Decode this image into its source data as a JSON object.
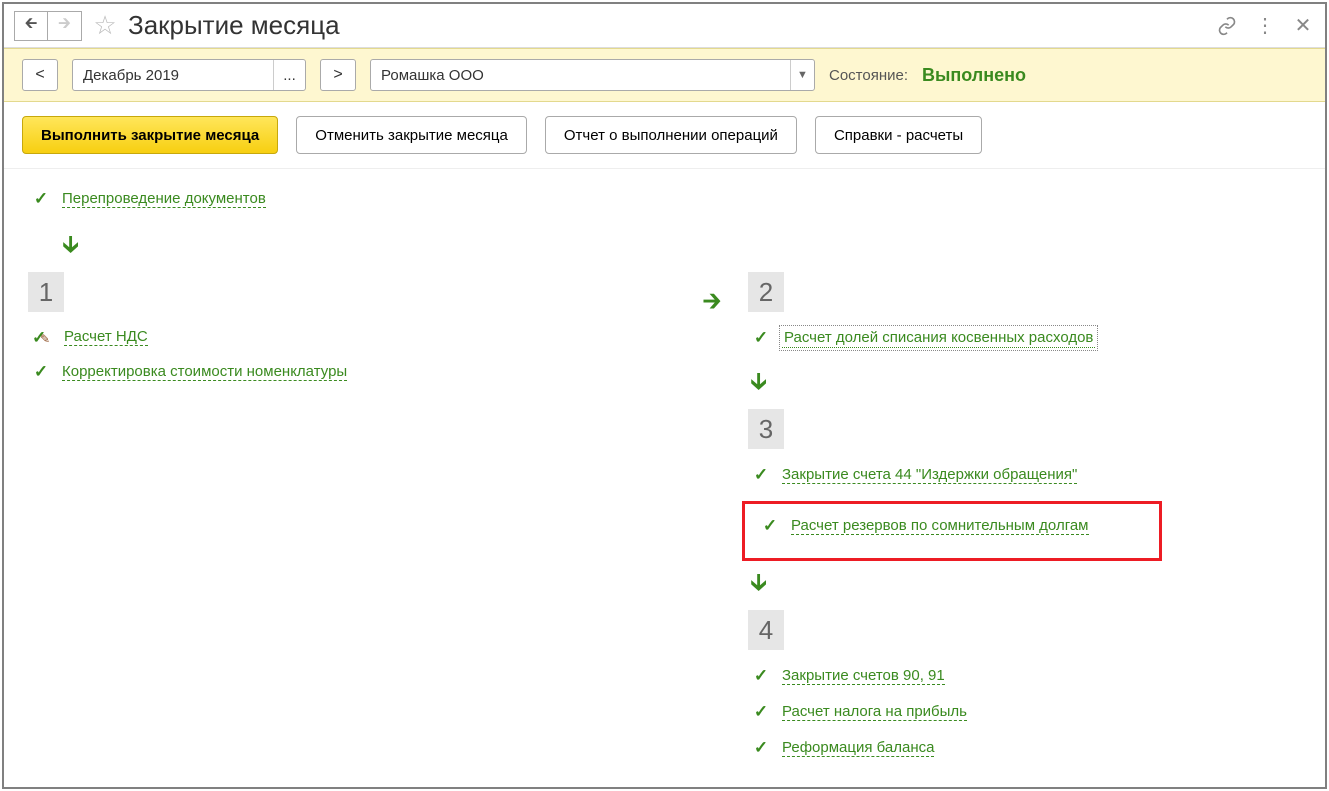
{
  "title": "Закрытие месяца",
  "period": {
    "value": "Декабрь 2019",
    "prev": "<",
    "next": ">",
    "more": "..."
  },
  "org": {
    "value": "Ромашка ООО"
  },
  "status": {
    "label": "Состояние:",
    "value": "Выполнено"
  },
  "toolbar": {
    "run": "Выполнить закрытие месяца",
    "cancel": "Отменить закрытие месяца",
    "report": "Отчет о выполнении операций",
    "refs": "Справки - расчеты"
  },
  "top_operation": "Перепроведение документов",
  "stages": {
    "s1": {
      "num": "1",
      "items": [
        {
          "label": "Расчет НДС",
          "pencil": true
        },
        {
          "label": "Корректировка стоимости номенклатуры"
        }
      ]
    },
    "s2": {
      "num": "2",
      "items": [
        {
          "label": "Расчет долей списания косвенных расходов",
          "dotted": true
        }
      ]
    },
    "s3": {
      "num": "3",
      "items": [
        {
          "label": "Закрытие счета 44 \"Издержки обращения\""
        },
        {
          "label": "Расчет резервов по сомнительным долгам",
          "highlight": true
        }
      ]
    },
    "s4": {
      "num": "4",
      "items": [
        {
          "label": "Закрытие счетов 90, 91"
        },
        {
          "label": "Расчет налога на прибыль"
        },
        {
          "label": "Реформация баланса"
        }
      ]
    }
  }
}
